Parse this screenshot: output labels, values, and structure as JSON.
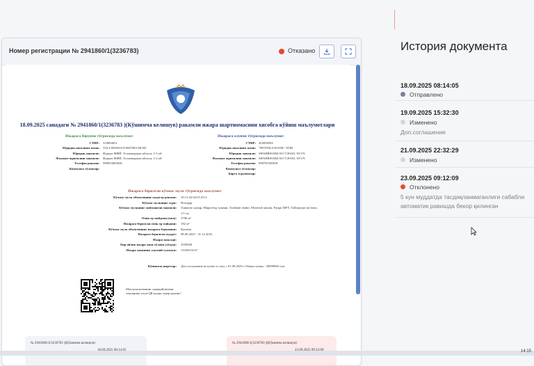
{
  "colors": {
    "accent": "#5c82c6",
    "rejected": "#e8492f",
    "sent": "#7a8293",
    "changed": "#d4d6da"
  },
  "header": {
    "reg_title": "Номер регистрации № 2941860/1(3236783)",
    "status": "Отказано",
    "download_icon": "download-icon",
    "expand_icon": "expand-icon"
  },
  "doc": {
    "title": "18.09.2025 санадаги № 2941860/1(3236783 )(Кўшимча келишув) ракамли ижара шартномасини хисобга кўйиш маълумотлари",
    "left_section": "Ижарага берувчи тўғрисида маълумот",
    "right_section": "Ижарага олувчи тўғрисида маълумот",
    "left_rows": [
      {
        "label": "СТИР:",
        "value": "310894651"
      },
      {
        "label": "Юридик шахснинг номи:",
        "value": "TALLIMARJAN BIZNES MCHJ"
      },
      {
        "label": "Юридик манзили:",
        "value": "Фурқат МФЙ, Толлимаржон кўчаси, 1/1-уй"
      },
      {
        "label": "Фаолият юритилиш манзили:",
        "value": "Фурқат МФЙ, Толлимаржон кўчаси, 1/1-уй"
      },
      {
        "label": "Телефон раками:",
        "value": "998953003828"
      },
      {
        "label": "Коммунал тўловлар:",
        "value": ""
      }
    ],
    "right_rows": [
      {
        "label": "СТИР:",
        "value": "202858493"
      },
      {
        "label": "Юридик шахснинг номи:",
        "value": "\"IPOTEKA-BANK\" ATIB"
      },
      {
        "label": "Юридик манзили:",
        "value": "SHAHRISABZ KO`CHASI, 30-UY"
      },
      {
        "label": "Фаолият юритилиш манзили:",
        "value": "SHAHRISABZ KO`CHASI, 30-UY"
      },
      {
        "label": "Телефон раками:",
        "value": "998781500818"
      },
      {
        "label": "Коммунал тўловлар:",
        "value": ""
      },
      {
        "label": "Бирга турувчилар:",
        "value": ""
      }
    ],
    "property_section": "Ижарага берилган кўчмас мулк тўғрисида маълумот",
    "property_rows": [
      {
        "label": "Кўчмас мулк объектининг кадастр раками:",
        "value": "10:11:42:02:01:0111"
      },
      {
        "label": "Кўчмас мулкнинг тури:",
        "value": "Нотурар"
      },
      {
        "label": "Кўчмас мулкнинг жойлашган манзили:",
        "value": "Тошкент шахар, Мирзобод тумани, Toshkent shahri, Mirobod tumani, Furqat MFY, Tallimarjon ko'chasi,"
      },
      {
        "label": "",
        "value": "1/1-uy"
      },
      {
        "label": "Очик ер майдони (мкв):",
        "value": "3786 м²"
      },
      {
        "label": "Ижарага берилган очик ер майдони:",
        "value": "182 м²"
      },
      {
        "label": "Кўчмас мулк объектининг ижарага берилиши:",
        "value": "Қисман"
      },
      {
        "label": "Ижарага берилган муддат:",
        "value": "08.09.2025 - 31.12.2025"
      },
      {
        "label": "Ижара максади:",
        "value": ""
      },
      {
        "label": "Бир ойлик ижара хаки тўлови (сўмда):",
        "value": "3550500"
      },
      {
        "label": "Ижара хакининг умумий суммаси:",
        "value": "13106516.67"
      }
    ],
    "extra_label": "Кўшимча шартлар:",
    "extra_value": "Доп.соглашение вступает в силу с 01.09.2025г. Общая сумма - 30000000 сум",
    "qr_text": "Маълумотномнинг ҳақиқийлигини текшириш учун QR-кодни скаер қилинг!",
    "card_left": {
      "title": "№ 2941860/1(3236783 )(Кўшимча келишув)",
      "date": "18.09.2025 08:14:05"
    },
    "card_right": {
      "title": "№ 2941860/1(3236783 )(Кўшимча келишув)",
      "date": "23.09.2025 09:12:09"
    }
  },
  "history": {
    "title": "История документа",
    "items": [
      {
        "date": "18.09.2025 08:14:05",
        "status": "Отправлено",
        "note": ""
      },
      {
        "date": "19.09.2025 15:32:30",
        "status": "Изменено",
        "note": "Доп.соглашение"
      },
      {
        "date": "21.09.2025 22:32:29",
        "status": "Изменено",
        "note": ""
      },
      {
        "date": "23.09.2025 09:12:09",
        "status": "Отклонено",
        "note": "5 кун муддатда тасдиқланмаганлиги сабабли автоматик равишда бекор қилинган"
      }
    ]
  },
  "taskbar": {
    "time": "14:15"
  }
}
